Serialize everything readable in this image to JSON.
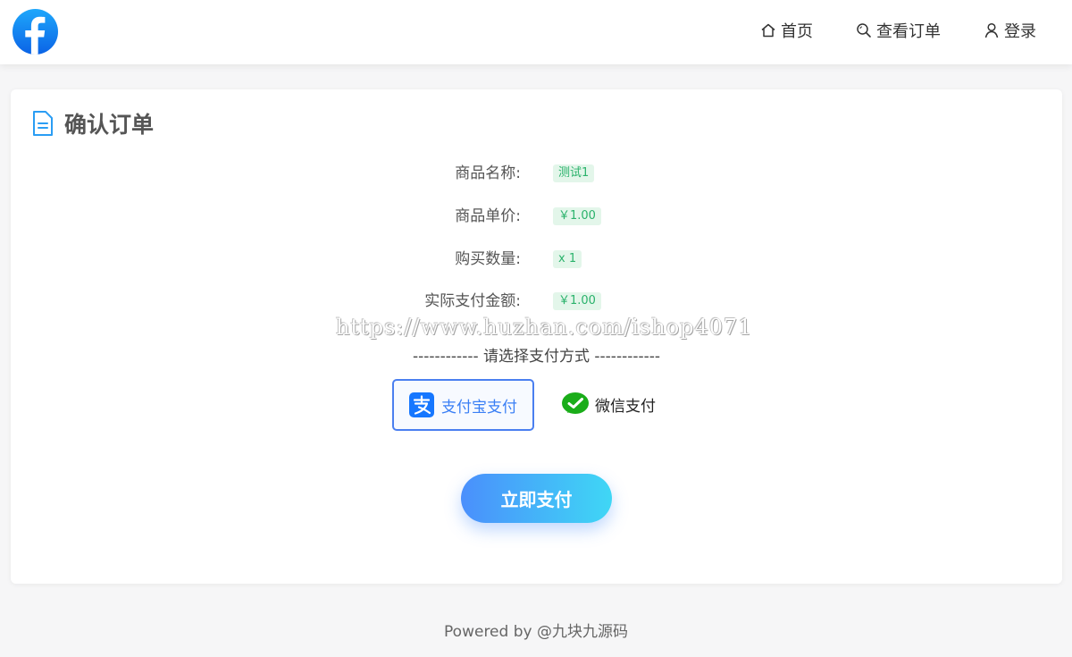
{
  "header": {
    "nav": {
      "home": "首页",
      "orders": "查看订单",
      "login": "登录"
    }
  },
  "card": {
    "title": "确认订单",
    "rows": [
      {
        "label": "商品名称:",
        "value": "测试1"
      },
      {
        "label": "商品单价:",
        "value": "￥1.00"
      },
      {
        "label": "购买数量:",
        "value": "x 1"
      },
      {
        "label": "实际支付金额:",
        "value": "￥1.00"
      }
    ],
    "watermark": "https://www.huzhan.com/ishop4071",
    "payment_prompt": "------------  请选择支付方式  ------------",
    "payment_methods": {
      "alipay": "支付宝支付",
      "wechat": "微信支付"
    },
    "pay_button": "立即支付"
  },
  "footer": {
    "text": "Powered by @九块九源码"
  },
  "colors": {
    "accent": "#4a7ff0",
    "tag_bg": "#e3f6ea",
    "tag_text": "#2ab26b",
    "wechat_green": "#1aad19",
    "alipay_blue": "#1677ff"
  }
}
